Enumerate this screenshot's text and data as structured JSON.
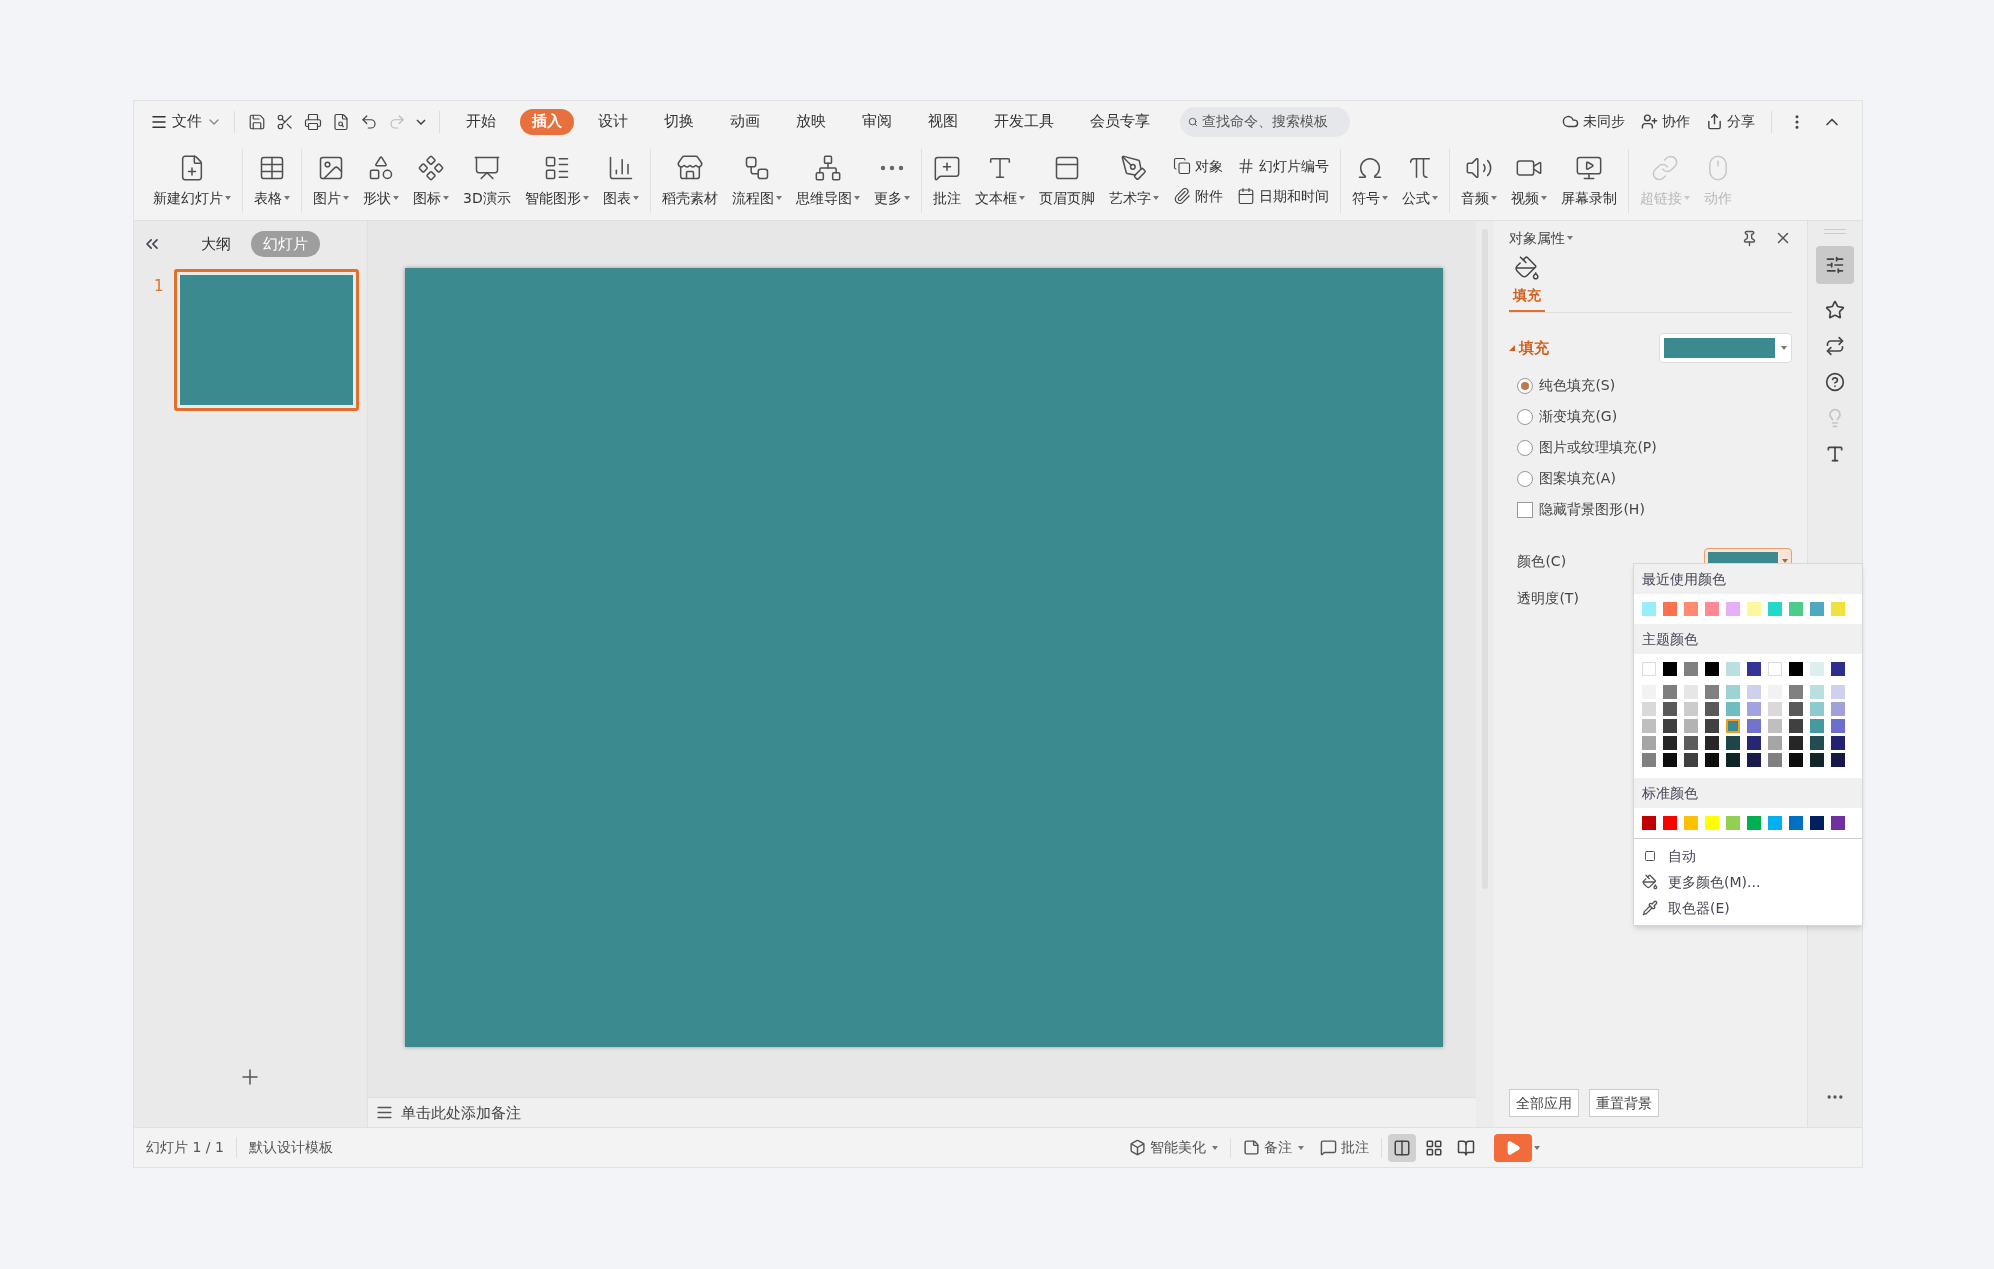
{
  "title_bar": {
    "file_menu": "文件",
    "tabs": [
      {
        "label": "开始",
        "selected": false
      },
      {
        "label": "插入",
        "selected": true
      },
      {
        "label": "设计",
        "selected": false
      },
      {
        "label": "切换",
        "selected": false
      },
      {
        "label": "动画",
        "selected": false
      },
      {
        "label": "放映",
        "selected": false
      },
      {
        "label": "审阅",
        "selected": false
      },
      {
        "label": "视图",
        "selected": false
      },
      {
        "label": "开发工具",
        "selected": false
      },
      {
        "label": "会员专享",
        "selected": false
      }
    ],
    "search": {
      "placeholder": "查找命令、搜索模板"
    },
    "actions": [
      "未同步",
      "协作",
      "分享"
    ]
  },
  "ribbon": [
    {
      "items": [
        {
          "label": "新建幻灯片",
          "kind": "large",
          "dropdown": true,
          "disabled": false
        }
      ]
    },
    {
      "items": [
        {
          "label": "表格",
          "kind": "large",
          "dropdown": true,
          "disabled": false
        }
      ]
    },
    {
      "items": [
        {
          "label": "图片",
          "kind": "large",
          "dropdown": true,
          "disabled": false
        },
        {
          "label": "形状",
          "kind": "large",
          "dropdown": true,
          "disabled": false
        },
        {
          "label": "图标",
          "kind": "large",
          "dropdown": true,
          "disabled": false
        },
        {
          "label": "3D演示",
          "kind": "large",
          "dropdown": false,
          "disabled": false
        },
        {
          "label": "智能图形",
          "kind": "large",
          "dropdown": true,
          "disabled": false
        },
        {
          "label": "图表",
          "kind": "large",
          "dropdown": true,
          "disabled": false
        }
      ]
    },
    {
      "items": [
        {
          "label": "稻壳素材",
          "kind": "large",
          "dropdown": false,
          "disabled": false
        },
        {
          "label": "流程图",
          "kind": "large",
          "dropdown": true,
          "disabled": false
        },
        {
          "label": "思维导图",
          "kind": "large",
          "dropdown": true,
          "disabled": false
        },
        {
          "label": "更多",
          "kind": "large",
          "dropdown": true,
          "disabled": false
        }
      ]
    },
    {
      "items": [
        {
          "label": "批注",
          "kind": "large",
          "dropdown": false,
          "disabled": false
        },
        {
          "label": "文本框",
          "kind": "large",
          "dropdown": true,
          "disabled": false
        },
        {
          "label": "页眉页脚",
          "kind": "large",
          "dropdown": false,
          "disabled": false
        },
        {
          "label": "艺术字",
          "kind": "large",
          "dropdown": true,
          "disabled": false
        },
        {
          "label": "对象",
          "kind": "small",
          "dropdown": false,
          "disabled": false
        },
        {
          "label": "附件",
          "kind": "small",
          "dropdown": false,
          "disabled": false
        },
        {
          "label": "幻灯片编号",
          "kind": "small",
          "dropdown": false,
          "disabled": false
        },
        {
          "label": "日期和时间",
          "kind": "small",
          "dropdown": false,
          "disabled": false
        }
      ]
    },
    {
      "items": [
        {
          "label": "符号",
          "kind": "large",
          "dropdown": true,
          "disabled": false
        },
        {
          "label": "公式",
          "kind": "large",
          "dropdown": true,
          "disabled": false
        }
      ]
    },
    {
      "items": [
        {
          "label": "音频",
          "kind": "large",
          "dropdown": true,
          "disabled": false
        },
        {
          "label": "视频",
          "kind": "large",
          "dropdown": true,
          "disabled": false
        },
        {
          "label": "屏幕录制",
          "kind": "large",
          "dropdown": false,
          "disabled": false
        }
      ]
    },
    {
      "items": [
        {
          "label": "超链接",
          "kind": "large",
          "dropdown": true,
          "disabled": true
        },
        {
          "label": "动作",
          "kind": "large",
          "dropdown": false,
          "disabled": true
        }
      ]
    }
  ],
  "slide_panel": {
    "tabs": [
      {
        "label": "大纲",
        "selected": false
      },
      {
        "label": "幻灯片",
        "selected": true
      }
    ],
    "slides": [
      {
        "number": "1",
        "selected": true,
        "color": "#3b8a8f"
      }
    ]
  },
  "notes": {
    "placeholder": "单击此处添加备注"
  },
  "properties": {
    "title": "对象属性",
    "tabs": [
      {
        "label": "填充",
        "selected": true
      }
    ],
    "section": {
      "label": "填充",
      "expanded": true,
      "color": "#3b8a8f"
    },
    "options": [
      {
        "label": "纯色填充(S)",
        "kind": "radio",
        "selected": true
      },
      {
        "label": "渐变填充(G)",
        "kind": "radio",
        "selected": false
      },
      {
        "label": "图片或纹理填充(P)",
        "kind": "radio",
        "selected": false
      },
      {
        "label": "图案填充(A)",
        "kind": "radio",
        "selected": false
      },
      {
        "label": "隐藏背景图形(H)",
        "kind": "checkbox",
        "checked": false
      }
    ],
    "color_label": "颜色(C)",
    "color": "#3b8a8f",
    "transparency_label": "透明度(T)",
    "buttons": [
      "全部应用",
      "重置背景"
    ]
  },
  "color_menu": {
    "recent_label": "最近使用颜色",
    "recent": [
      {
        "color": "#9aeef8"
      },
      {
        "color": "#ff7050"
      },
      {
        "color": "#ff8a70"
      },
      {
        "color": "#ff8896"
      },
      {
        "color": "#e4b0f8"
      },
      {
        "color": "#fbf8a0"
      },
      {
        "color": "#22d9c9"
      },
      {
        "color": "#4ccc88"
      },
      {
        "color": "#4ea9c0"
      },
      {
        "color": "#f0e040"
      }
    ],
    "theme_label": "主题颜色",
    "theme_rows": [
      [
        {
          "color": "#ffffff",
          "selected": false
        },
        {
          "color": "#000000",
          "selected": false
        },
        {
          "color": "#808080",
          "selected": false
        },
        {
          "color": "#000000",
          "selected": false
        },
        {
          "color": "#b9dfe1",
          "selected": false
        },
        {
          "color": "#333399",
          "selected": false
        },
        {
          "color": "#ffffff",
          "selected": false
        },
        {
          "color": "#000000",
          "selected": false
        },
        {
          "color": "#dbeef0",
          "selected": false
        },
        {
          "color": "#2e2e8c",
          "selected": false
        }
      ],
      [
        {
          "color": "#f2f2f2",
          "selected": false
        },
        {
          "color": "#7f7f7f",
          "selected": false
        },
        {
          "color": "#e6e6e6",
          "selected": false
        },
        {
          "color": "#808080",
          "selected": false
        },
        {
          "color": "#9ed3d6",
          "selected": false
        },
        {
          "color": "#cfcfee",
          "selected": false
        },
        {
          "color": "#f2f2f2",
          "selected": false
        },
        {
          "color": "#808080",
          "selected": false
        },
        {
          "color": "#b9dfe1",
          "selected": false
        },
        {
          "color": "#cfcfee",
          "selected": false
        }
      ],
      [
        {
          "color": "#d9d9d9",
          "selected": false
        },
        {
          "color": "#595959",
          "selected": false
        },
        {
          "color": "#cccccc",
          "selected": false
        },
        {
          "color": "#595959",
          "selected": false
        },
        {
          "color": "#6fbcc1",
          "selected": false
        },
        {
          "color": "#a2a2e0",
          "selected": false
        },
        {
          "color": "#d9d9d9",
          "selected": false
        },
        {
          "color": "#595959",
          "selected": false
        },
        {
          "color": "#8ccacd",
          "selected": false
        },
        {
          "color": "#a0a0dd",
          "selected": false
        }
      ],
      [
        {
          "color": "#bfbfbf",
          "selected": false
        },
        {
          "color": "#3f3f3f",
          "selected": false
        },
        {
          "color": "#b3b3b3",
          "selected": false
        },
        {
          "color": "#404040",
          "selected": false
        },
        {
          "color": "#3b8a8f",
          "selected": true
        },
        {
          "color": "#7272cf",
          "selected": false
        },
        {
          "color": "#bfbfbf",
          "selected": false
        },
        {
          "color": "#404040",
          "selected": false
        },
        {
          "color": "#449a9f",
          "selected": false
        },
        {
          "color": "#6e6ecf",
          "selected": false
        }
      ],
      [
        {
          "color": "#a6a6a6",
          "selected": false
        },
        {
          "color": "#262626",
          "selected": false
        },
        {
          "color": "#5c5c5c",
          "selected": false
        },
        {
          "color": "#262626",
          "selected": false
        },
        {
          "color": "#1e4548",
          "selected": false
        },
        {
          "color": "#262673",
          "selected": false
        },
        {
          "color": "#a6a6a6",
          "selected": false
        },
        {
          "color": "#262626",
          "selected": false
        },
        {
          "color": "#224d50",
          "selected": false
        },
        {
          "color": "#222270",
          "selected": false
        }
      ],
      [
        {
          "color": "#808080",
          "selected": false
        },
        {
          "color": "#0d0d0d",
          "selected": false
        },
        {
          "color": "#404040",
          "selected": false
        },
        {
          "color": "#0d0d0d",
          "selected": false
        },
        {
          "color": "#0f2224",
          "selected": false
        },
        {
          "color": "#1a1a4d",
          "selected": false
        },
        {
          "color": "#808080",
          "selected": false
        },
        {
          "color": "#0d0d0d",
          "selected": false
        },
        {
          "color": "#112628",
          "selected": false
        },
        {
          "color": "#17174b",
          "selected": false
        }
      ]
    ],
    "standard_label": "标准颜色",
    "standard": [
      {
        "color": "#c00000"
      },
      {
        "color": "#ff0000"
      },
      {
        "color": "#ffc000"
      },
      {
        "color": "#ffff00"
      },
      {
        "color": "#92d050"
      },
      {
        "color": "#00b050"
      },
      {
        "color": "#00b0f0"
      },
      {
        "color": "#0070c0"
      },
      {
        "color": "#002060"
      },
      {
        "color": "#7030a0"
      }
    ],
    "items": [
      "自动",
      "更多颜色(M)...",
      "取色器(E)"
    ]
  },
  "status_bar": {
    "slide_count": "幻灯片 1 / 1",
    "template": "默认设计模板",
    "beautify": "智能美化",
    "notes": "备注",
    "comments": "批注",
    "views": [
      {
        "selected": true
      },
      {
        "selected": false
      },
      {
        "selected": false
      }
    ]
  }
}
